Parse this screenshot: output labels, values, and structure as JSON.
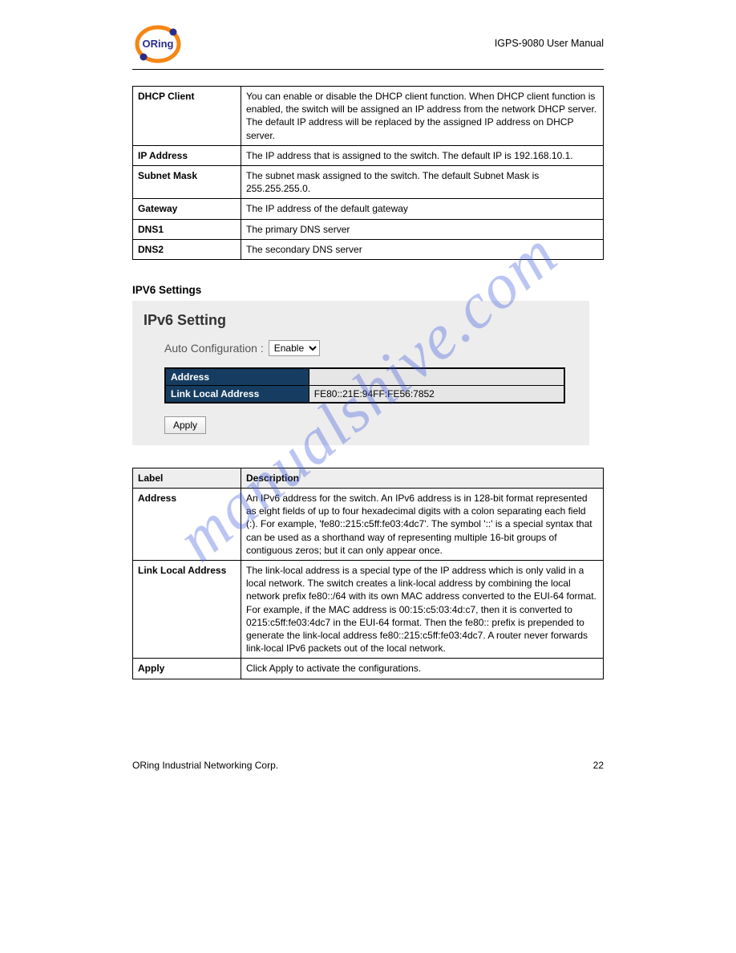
{
  "header": {
    "doc_title": "IGPS-9080 User Manual"
  },
  "table1": {
    "rows": [
      {
        "label": "DHCP Client",
        "desc": "You can enable or disable the DHCP client function. When DHCP client function is enabled, the switch will be assigned an IP address from the network DHCP server. The default IP address will be replaced by the assigned IP address on DHCP server."
      },
      {
        "label": "IP Address",
        "desc": "The IP address that is assigned to the switch. The default IP is 192.168.10.1."
      },
      {
        "label": "Subnet Mask",
        "desc": "The subnet mask assigned to the switch. The default Subnet Mask is 255.255.255.0."
      },
      {
        "label": "Gateway",
        "desc": "The IP address of the default gateway"
      },
      {
        "label": "DNS1",
        "desc": "The primary DNS server"
      },
      {
        "label": "DNS2",
        "desc": "The secondary DNS server"
      }
    ]
  },
  "section": {
    "heading": "IPV6 Settings"
  },
  "screenshot": {
    "title": "IPv6 Setting",
    "autoconf_label": "Auto Configuration :",
    "autoconf_option": "Enable",
    "rows": [
      {
        "label": "Address",
        "value": ""
      },
      {
        "label": "Link Local Address",
        "value": "FE80::21E:94FF:FE56:7852"
      }
    ],
    "apply_label": "Apply"
  },
  "table2": {
    "header_label": "Label",
    "header_desc": "Description",
    "rows": [
      {
        "label": "Address",
        "desc": "An IPv6 address for the switch. An IPv6 address is in 128-bit format represented as eight fields of up to four hexadecimal digits with a colon separating each field (:). For example, 'fe80::215:c5ff:fe03:4dc7'. The symbol '::' is a special syntax that can be used as a shorthand way of representing multiple 16-bit groups of contiguous zeros; but it can only appear once."
      },
      {
        "label": "Link Local Address",
        "desc": "The link-local address is a special type of the IP address which is only valid in a local network. The switch creates a link-local address by combining the local network prefix fe80::/64 with its own MAC address converted to the EUI-64 format. For example, if the MAC address is 00:15:c5:03:4d:c7, then it is converted to 0215:c5ff:fe03:4dc7 in the EUI-64 format. Then the fe80:: prefix is prepended to generate the link-local address fe80::215:c5ff:fe03:4dc7. A router never forwards link-local IPv6 packets out of the local network."
      },
      {
        "label": "Apply",
        "desc": "Click Apply to activate the configurations."
      }
    ]
  },
  "footer": {
    "copyright": "ORing Industrial Networking Corp.",
    "page": "22"
  },
  "watermark": "manualshive.com"
}
